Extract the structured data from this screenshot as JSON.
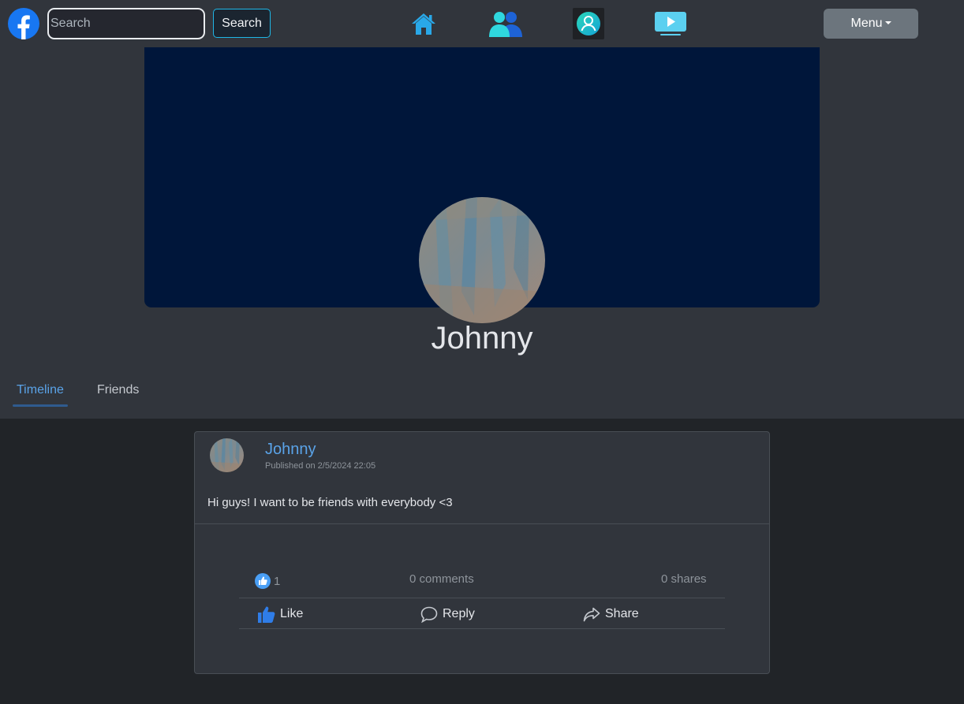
{
  "navbar": {
    "search_placeholder": "Search",
    "search_button": "Search",
    "menu_label": "Menu",
    "icons": [
      "facebook-logo-icon",
      "home-icon",
      "friends-icon",
      "profile-icon",
      "watch-icon"
    ]
  },
  "profile": {
    "name": "Johnny",
    "tabs": [
      {
        "label": "Timeline",
        "active": true
      },
      {
        "label": "Friends",
        "active": false
      }
    ]
  },
  "post": {
    "author": "Johnny",
    "published": "Published on 2/5/2024 22:05",
    "text": "Hi guys! I want to be friends with everybody <3",
    "like_count": "1",
    "comments": "0 comments",
    "shares": "0 shares",
    "actions": {
      "like": "Like",
      "reply": "Reply",
      "share": "Share"
    }
  },
  "colors": {
    "nav_bg": "#31353c",
    "page_bg": "#212428",
    "cover": "#00163a",
    "accent_link": "#5aa3e8",
    "search_border": "#1fb6e6",
    "menu_button": "#6c757d"
  }
}
